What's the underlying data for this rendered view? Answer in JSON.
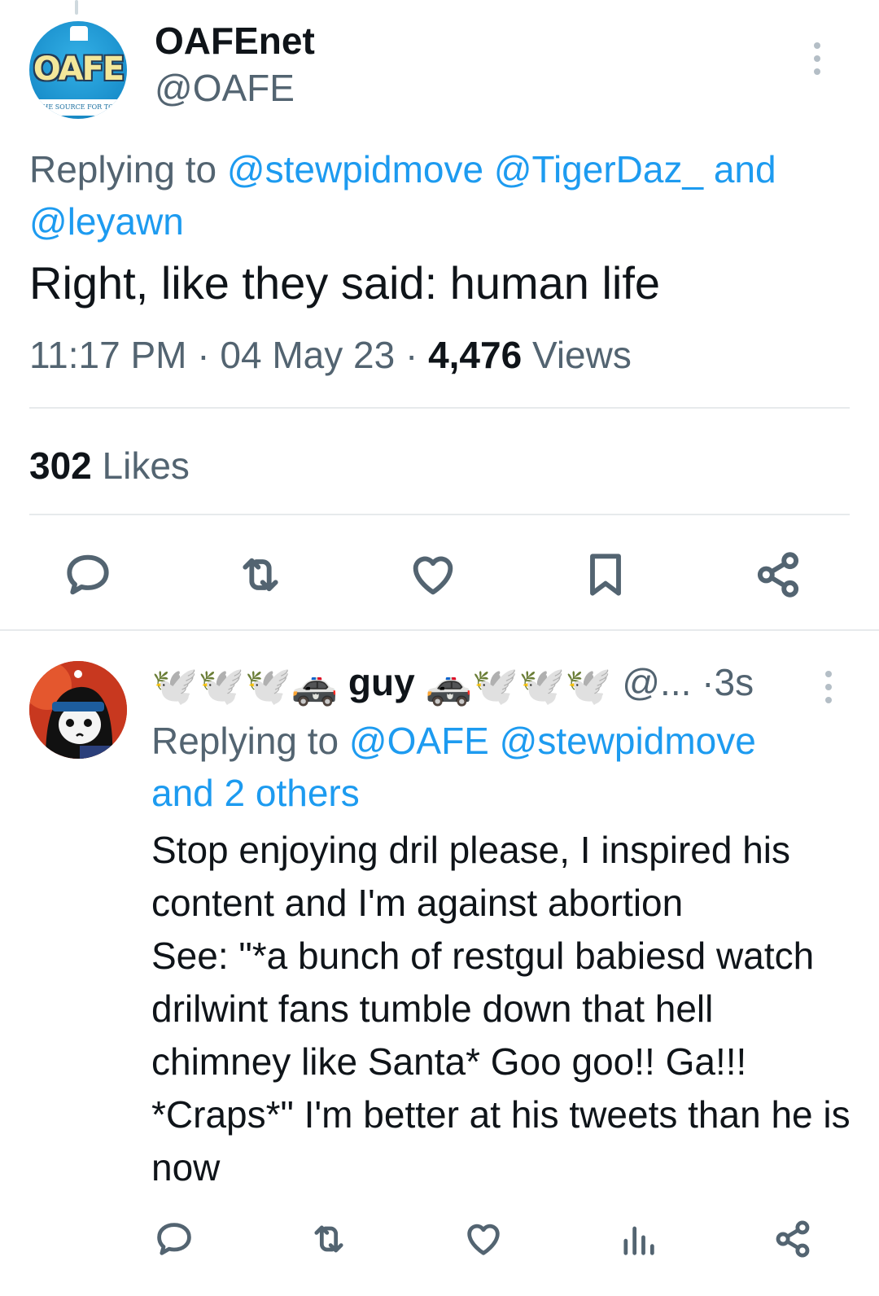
{
  "main_tweet": {
    "avatar": {
      "logo_text": "OAFE",
      "tagline": "THE SOURCE FOR TOY REVIEWS"
    },
    "display_name": "OAFEnet",
    "handle": "@OAFE",
    "replying_prefix": "Replying to ",
    "replying_mentions": [
      "@stewpidmove",
      "@TigerDaz_"
    ],
    "replying_and": "and",
    "replying_last": "@leyawn",
    "text": "Right, like they said: human life",
    "time": "11:17 PM",
    "sep": " · ",
    "date": "04 May 23",
    "views_count": "4,476",
    "views_label": "Views",
    "likes_count": "302",
    "likes_label": "Likes",
    "actions": [
      "reply-icon",
      "retweet-icon",
      "like-icon",
      "bookmark-icon",
      "share-icon"
    ]
  },
  "reply_tweet": {
    "name_prefix_emoji": "🕊️🕊️🕊️🚓",
    "display_name": "guy",
    "name_suffix_emoji": "🚓🕊️🕊️🕊️",
    "handle": "@...",
    "time_sep": "·",
    "time": "3s",
    "replying_prefix": "Replying to ",
    "replying_mentions": [
      "@OAFE",
      "@stewpidmove"
    ],
    "replying_others": "and 2 others",
    "text": "Stop enjoying dril please, I inspired his content and I'm against abortion\nSee: \"*a bunch of restgul babiesd watch drilwint fans tumble down that hell chimney like Santa* Goo goo!! Ga!!! *Craps*\" I'm better at his tweets than he is now",
    "actions": [
      "reply-icon",
      "retweet-icon",
      "like-icon",
      "analytics-icon",
      "share-icon"
    ]
  },
  "colors": {
    "accent": "#1d9bf0",
    "secondary_text": "#536471",
    "primary_text": "#0f1419",
    "icon": "#536471"
  }
}
